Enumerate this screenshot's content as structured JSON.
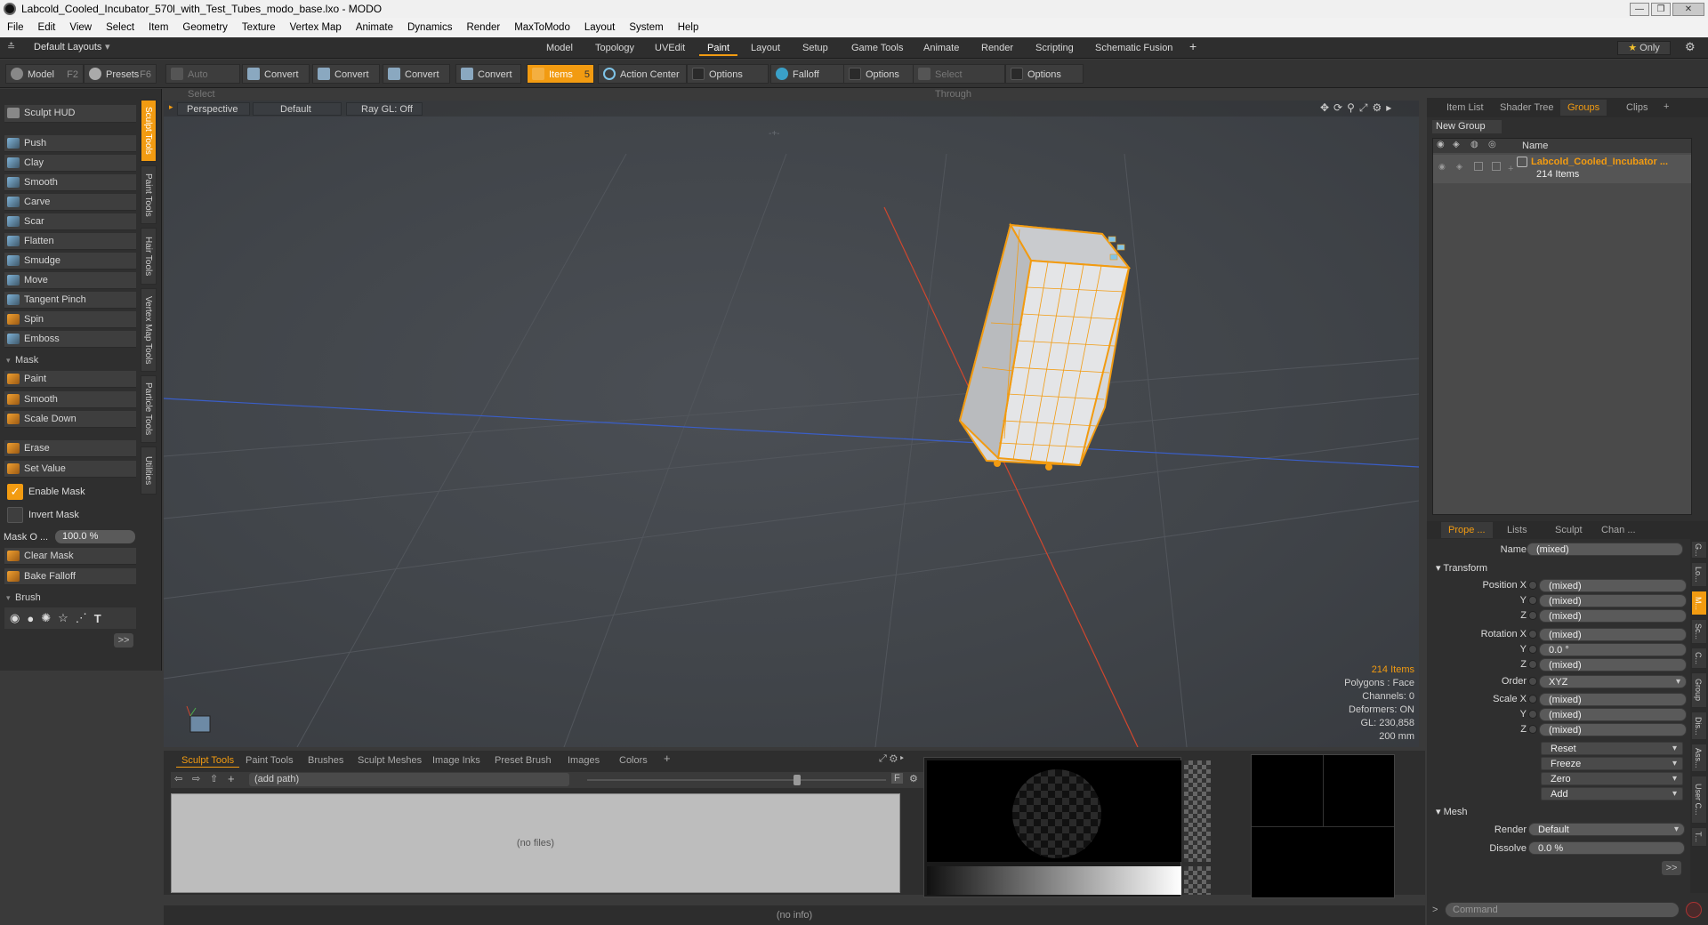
{
  "window": {
    "title": "Labcold_Cooled_Incubator_570l_with_Test_Tubes_modo_base.lxo - MODO"
  },
  "menu": [
    "File",
    "Edit",
    "View",
    "Select",
    "Item",
    "Geometry",
    "Texture",
    "Vertex Map",
    "Animate",
    "Dynamics",
    "Render",
    "MaxToModo",
    "Layout",
    "System",
    "Help"
  ],
  "layouts": {
    "current": "Default Layouts",
    "tabs": [
      "Model",
      "Topology",
      "UVEdit",
      "Paint",
      "Layout",
      "Setup",
      "Game Tools",
      "Animate",
      "Render",
      "Scripting",
      "Schematic Fusion"
    ],
    "selected": "Paint",
    "plus": "+",
    "only": "Only"
  },
  "toolbar": {
    "model": "Model",
    "model_key": "F2",
    "presets": "Presets",
    "presets_key": "F6",
    "auto_select": "Auto Select",
    "convert": "Convert",
    "items": "Items",
    "items_key": "5",
    "action_center": "Action Center",
    "options": "Options",
    "falloff": "Falloff",
    "select_through": "Select Through"
  },
  "sculpt": {
    "hud": "Sculpt HUD",
    "tools": [
      "Push",
      "Clay",
      "Smooth",
      "Carve",
      "Scar",
      "Flatten",
      "Smudge",
      "Move",
      "Tangent Pinch",
      "Spin",
      "Emboss"
    ],
    "mask_header": "Mask",
    "mask_tools": [
      "Paint",
      "Smooth",
      "Scale Down"
    ],
    "erase": "Erase",
    "set_value": "Set Value",
    "enable_mask": "Enable Mask",
    "invert_mask": "Invert Mask",
    "mask_opacity_label": "Mask O ...",
    "mask_opacity": "100.0 %",
    "clear_mask": "Clear Mask",
    "bake_falloff": "Bake Falloff",
    "brush_header": "Brush",
    "more": ">>"
  },
  "vtabs": [
    "Sculpt Tools",
    "Paint Tools",
    "Hair Tools",
    "Vertex Map Tools",
    "Particle Tools",
    "Utilities"
  ],
  "viewport": {
    "view": "Perspective",
    "shading": "Default",
    "raygl": "Ray GL: Off",
    "info": {
      "items": "214 Items",
      "polygons": "Polygons : Face",
      "channels": "Channels: 0",
      "deformers": "Deformers: ON",
      "gl": "GL: 230,858",
      "scale": "200 mm"
    }
  },
  "bottom": {
    "tabs": [
      "Sculpt Tools",
      "Paint Tools",
      "Brushes",
      "Sculpt Meshes",
      "Image Inks",
      "Preset Brush",
      "Images",
      "Colors"
    ],
    "plus": "+",
    "path": "(add path)",
    "nofiles": "(no files)",
    "f": "F",
    "status": "(no info)"
  },
  "right": {
    "tabs": [
      "Item List",
      "Shader Tree",
      "Groups",
      "Clips"
    ],
    "selected": "Groups",
    "plus": "+",
    "new_group": "New Group",
    "col_name": "Name",
    "group": {
      "name": "Labcold_Cooled_Incubator ...",
      "count": "214 Items"
    },
    "prop_tabs": [
      "Prope ...",
      "Lists",
      "Sculpt",
      "Chan ..."
    ],
    "name_label": "Name",
    "name_value": "(mixed)",
    "transform": "Transform",
    "rows": [
      [
        "Position X",
        "(mixed)"
      ],
      [
        "Y",
        "(mixed)"
      ],
      [
        "Z",
        "(mixed)"
      ],
      [
        "Rotation X",
        "(mixed)"
      ],
      [
        "Y",
        "0.0 °"
      ],
      [
        "Z",
        "(mixed)"
      ],
      [
        "Order",
        "XYZ"
      ],
      [
        "Scale X",
        "(mixed)"
      ],
      [
        "Y",
        "(mixed)"
      ],
      [
        "Z",
        "(mixed)"
      ]
    ],
    "actions": [
      "Reset",
      "Freeze",
      "Zero",
      "Add"
    ],
    "mesh": "Mesh",
    "render_label": "Render",
    "render_value": "Default",
    "dissolve_label": "Dissolve",
    "dissolve_value": "0.0 %",
    "more": ">>",
    "command": "Command",
    "side_tabs": [
      "G...",
      "Lo...",
      "M...",
      "Sc...",
      "C...",
      "Group",
      "Dis...",
      "Ass...",
      "User C...",
      "T..."
    ]
  },
  "colors": {
    "accent": "#f29b11",
    "x_axis": "#d0472e",
    "z_axis": "#3a5ec8"
  }
}
